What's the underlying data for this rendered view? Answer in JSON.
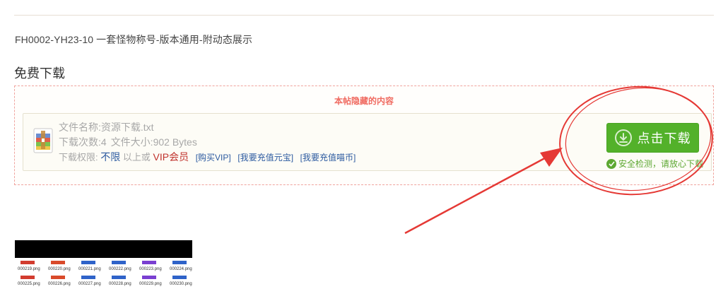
{
  "post": {
    "title": "FH0002-YH23-10 一套怪物称号-版本通用-附动态展示",
    "section_heading": "免费下载"
  },
  "hidden_box": {
    "label": "本帖隐藏的内容"
  },
  "file": {
    "name_line": "文件名称:资源下载.txt",
    "count_label": "下载次数:4",
    "size_label": "文件大小:902 Bytes",
    "permission_label": "下载权限:",
    "permission_value": "不限",
    "above_label": "以上或",
    "vip_label": "VIP会员",
    "links": [
      "[购买VIP]",
      "[我要充值元宝]",
      "[我要充值喵币]"
    ]
  },
  "download": {
    "button_label": "点击下载",
    "safe_note": "安全检测，请放心下载"
  },
  "thumbnail": {
    "rows": [
      [
        "000219.png",
        "000220.png",
        "000221.png",
        "000222.png",
        "000223.png",
        "000224.png"
      ],
      [
        "000225.png",
        "000226.png",
        "000227.png",
        "000228.png",
        "000229.png",
        "000230.png"
      ]
    ]
  },
  "colors": {
    "accent_green": "#53b12a",
    "annotation_red": "#e53935",
    "hidden_label": "#f06b61",
    "link_blue": "#2c5aa0",
    "vip_red": "#c0322c"
  },
  "icons": {
    "file": "archive-file-icon",
    "download": "download-arrow-icon",
    "safe": "check-circle-icon"
  }
}
